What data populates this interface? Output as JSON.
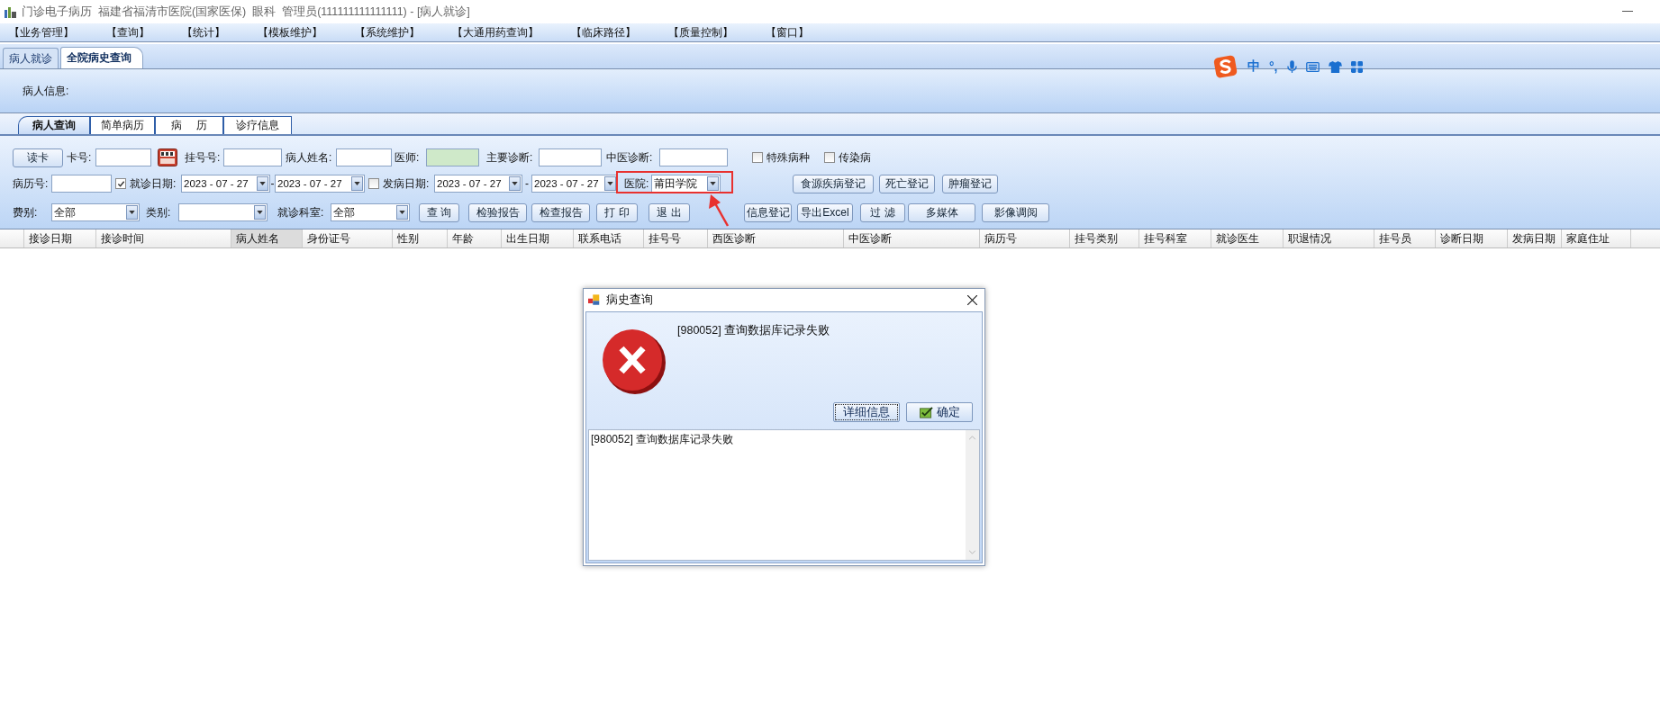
{
  "window": {
    "title": "门诊电子病历  福建省福清市医院(国家医保)  眼科  管理员(111111111111111) - [病人就诊]"
  },
  "menu": [
    "【业务管理】",
    "【查询】",
    "【统计】",
    "【模板维护】",
    "【系统维护】",
    "【大通用药查询】",
    "【临床路径】",
    "【质量控制】",
    "【窗口】"
  ],
  "doc_tabs": [
    {
      "label": "病人就诊",
      "selected": false
    },
    {
      "label": "全院病史查询",
      "selected": true
    }
  ],
  "ime_toolbar": {
    "mode": "中",
    "punctuation": "°,"
  },
  "patient_info": {
    "label": "病人信息:"
  },
  "sub_tabs": [
    {
      "label": "病人查询",
      "selected": true
    },
    {
      "label": "简单病历",
      "selected": false
    },
    {
      "label": "病　 历",
      "selected": false
    },
    {
      "label": "诊疗信息",
      "selected": false
    }
  ],
  "filters": [
    [
      {
        "kind": "button",
        "text": "读卡"
      },
      {
        "kind": "label",
        "text": "卡号:"
      },
      {
        "kind": "field"
      },
      {
        "kind": "reader"
      },
      {
        "kind": "label",
        "text": "挂号号:"
      },
      {
        "kind": "field"
      },
      {
        "kind": "label",
        "text": "病人姓名:"
      },
      {
        "kind": "field"
      },
      {
        "kind": "label",
        "text": "医师:"
      },
      {
        "kind": "field",
        "color": "#cfe9c9"
      },
      {
        "kind": "label",
        "text": "主要诊断:"
      },
      {
        "kind": "field"
      },
      {
        "kind": "label",
        "text": "中医诊断:"
      },
      {
        "kind": "field"
      },
      {
        "kind": "checkbox",
        "text": "特殊病种",
        "checked": false
      },
      {
        "kind": "checkbox",
        "text": "传染病",
        "checked": false
      }
    ],
    [
      {
        "kind": "label",
        "text": "病历号:"
      },
      {
        "kind": "field"
      },
      {
        "kind": "checkbox",
        "text": "就诊日期:",
        "checked": true
      },
      {
        "kind": "date",
        "value": "2023 - 07 - 27"
      },
      {
        "kind": "dash",
        "text": "-"
      },
      {
        "kind": "date",
        "value": "2023 - 07 - 27"
      },
      {
        "kind": "checkbox",
        "text": "发病日期:",
        "checked": false
      },
      {
        "kind": "date",
        "value": "2023 - 07 - 27"
      },
      {
        "kind": "dash",
        "text": "-"
      },
      {
        "kind": "date",
        "value": "2023 - 07 - 27"
      },
      {
        "kind": "label",
        "text": "医院:"
      },
      {
        "kind": "combo",
        "value": "莆田学院"
      },
      {
        "kind": "button",
        "text": "食源疾病登记"
      },
      {
        "kind": "button",
        "text": "死亡登记"
      },
      {
        "kind": "button",
        "text": "肿瘤登记"
      }
    ],
    [
      {
        "kind": "label",
        "text": "费别:"
      },
      {
        "kind": "combo",
        "value": "全部"
      },
      {
        "kind": "label",
        "text": "类别:"
      },
      {
        "kind": "combo"
      },
      {
        "kind": "label",
        "text": "就诊科室:"
      },
      {
        "kind": "combo",
        "value": "全部"
      },
      {
        "kind": "button",
        "text": "查 询"
      },
      {
        "kind": "button",
        "text": "检验报告"
      },
      {
        "kind": "button",
        "text": "检查报告"
      },
      {
        "kind": "button",
        "text": "打 印"
      },
      {
        "kind": "button",
        "text": "退 出"
      },
      {
        "kind": "button",
        "text": "信息登记"
      },
      {
        "kind": "button",
        "text": "导出Excel"
      },
      {
        "kind": "button",
        "text": "过 滤"
      },
      {
        "kind": "button",
        "text": "多媒体"
      },
      {
        "kind": "button",
        "text": "影像调阅"
      }
    ]
  ],
  "table": {
    "columns": [
      {
        "label": "接诊日期",
        "selected": false
      },
      {
        "label": "接诊时间",
        "selected": false
      },
      {
        "label": "病人姓名",
        "selected": true
      },
      {
        "label": "身份证号",
        "selected": false
      },
      {
        "label": "性别",
        "selected": false
      },
      {
        "label": "年龄",
        "selected": false
      },
      {
        "label": "出生日期",
        "selected": false
      },
      {
        "label": "联系电话",
        "selected": false
      },
      {
        "label": "挂号号",
        "selected": false
      },
      {
        "label": "西医诊断",
        "selected": false
      },
      {
        "label": "中医诊断",
        "selected": false
      },
      {
        "label": "病历号",
        "selected": false
      },
      {
        "label": "挂号类别",
        "selected": false
      },
      {
        "label": "挂号科室",
        "selected": false
      },
      {
        "label": "就诊医生",
        "selected": false
      },
      {
        "label": "职退情况",
        "selected": false
      },
      {
        "label": "挂号员",
        "selected": false
      },
      {
        "label": "诊断日期",
        "selected": false
      },
      {
        "label": "发病日期",
        "selected": false
      },
      {
        "label": "家庭住址",
        "selected": false
      }
    ]
  },
  "dialog": {
    "title": "病史查询",
    "message": "[980052] 查询数据库记录失败",
    "buttons": [
      {
        "kind": "details",
        "label": "详细信息"
      },
      {
        "kind": "ok",
        "label": "确定"
      }
    ],
    "details": "[980052] 查询数据库记录失败"
  }
}
